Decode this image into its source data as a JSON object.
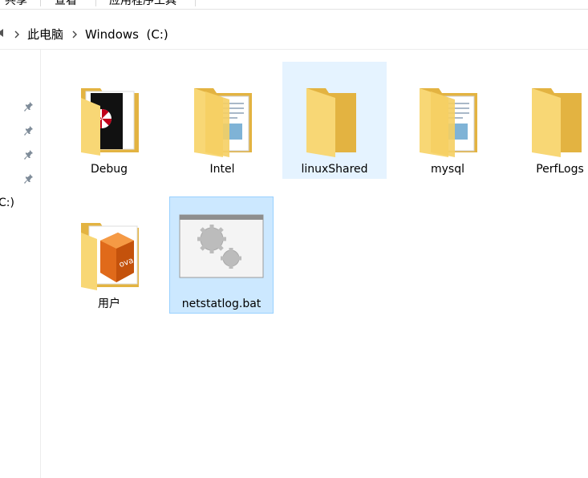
{
  "ribbon": {
    "tabs": [
      {
        "label": "共享"
      },
      {
        "label": "查看"
      },
      {
        "label": "应用程序工具"
      }
    ]
  },
  "address": {
    "crumbs": [
      {
        "label": "此电脑"
      },
      {
        "label": "Windows  (C:)"
      }
    ]
  },
  "nav": {
    "drive_label": "C:)"
  },
  "items": [
    {
      "label": "Debug",
      "type": "folder-document"
    },
    {
      "label": "Intel",
      "type": "folder-pages"
    },
    {
      "label": "linuxShared",
      "type": "folder-empty",
      "state": "hover"
    },
    {
      "label": "mysql",
      "type": "folder-pages"
    },
    {
      "label": "PerfLogs",
      "type": "folder-empty"
    },
    {
      "label": "用户",
      "type": "folder-ova"
    },
    {
      "label": "netstatlog.bat",
      "type": "batch-file",
      "state": "selected"
    }
  ],
  "colors": {
    "folder": "#f8d775",
    "folder_dark": "#e3b341",
    "hover": "#e5f3ff",
    "selected": "#cce8ff",
    "selected_border": "#99d1ff"
  }
}
